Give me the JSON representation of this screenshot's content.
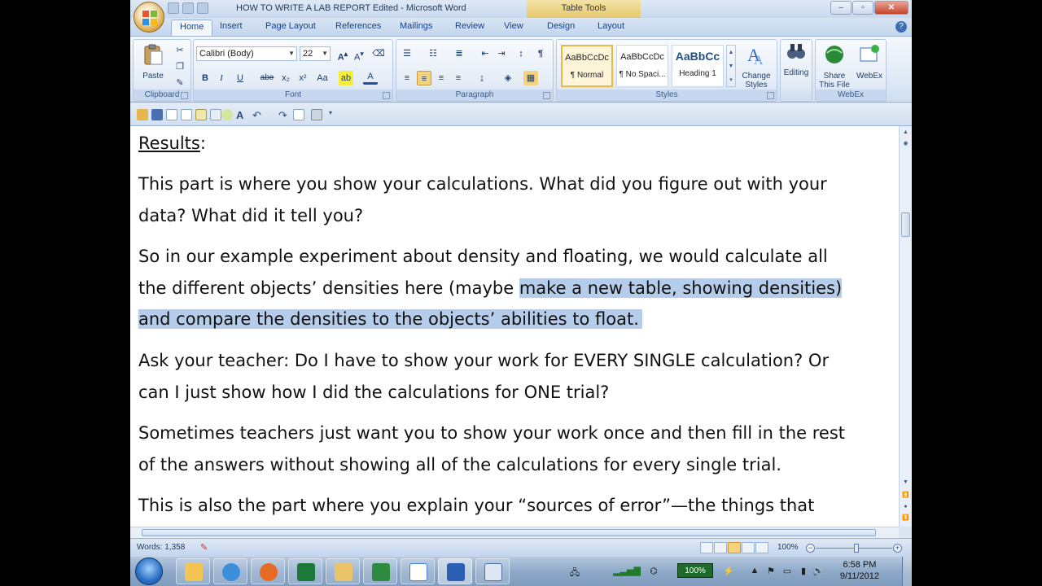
{
  "window": {
    "title": "HOW TO WRITE A LAB REPORT Edited - Microsoft Word",
    "context_label": "Table Tools",
    "controls": {
      "minimize": "–",
      "maximize": "▫",
      "close": "✕"
    }
  },
  "tabs": [
    {
      "label": "Home"
    },
    {
      "label": "Insert"
    },
    {
      "label": "Page Layout"
    },
    {
      "label": "References"
    },
    {
      "label": "Mailings"
    },
    {
      "label": "Review"
    },
    {
      "label": "View"
    },
    {
      "label": "Design"
    },
    {
      "label": "Layout"
    }
  ],
  "ribbon": {
    "clipboard": {
      "label": "Clipboard",
      "paste": "Paste"
    },
    "font": {
      "label": "Font",
      "family": "Calibri (Body)",
      "size": "22",
      "buttons": [
        "B",
        "I",
        "U",
        "abe",
        "x₂",
        "x²",
        "Aa"
      ]
    },
    "paragraph": {
      "label": "Paragraph"
    },
    "styles": {
      "label": "Styles",
      "items": [
        {
          "sample": "AaBbCcDc",
          "name": "¶ Normal"
        },
        {
          "sample": "AaBbCcDc",
          "name": "¶ No Spaci..."
        },
        {
          "sample": "AaBbCc",
          "name": "Heading 1"
        }
      ],
      "change_styles": "Change Styles"
    },
    "editing": {
      "label": "Editing"
    },
    "webex": {
      "label": "WebEx",
      "share": "Share This File",
      "webex": "WebEx"
    }
  },
  "document": {
    "heading": "Results",
    "lines": [
      "This part is where you show your calculations.  What did you figure out with your",
      "data?  What did it tell you?",
      "So in our example experiment about density and floating, we would calculate all",
      "the different objects’ densities here (maybe ",
      "make a new table, showing densities)",
      "and compare the densities to the objects’ abilities to float.",
      "Ask your teacher:  Do I have to show your work for EVERY SINGLE calculation?  Or",
      "can I just show how I did the calculations for ONE trial?",
      "Sometimes teachers just want you to show your work once and then fill in the rest",
      "of the answers without showing all of the calculations for every single trial.",
      "This is also the part where you explain your “sources of error”—the things that"
    ]
  },
  "statusbar": {
    "words": "Words: 1,358",
    "zoom": "100%"
  },
  "taskbar": {
    "battery": "100%",
    "time": "6:58 PM",
    "date": "9/11/2012"
  },
  "colors": {
    "selection": "#b5cdea",
    "ribbon": "#dbe6f4",
    "tabletools": "#e8c96d"
  }
}
